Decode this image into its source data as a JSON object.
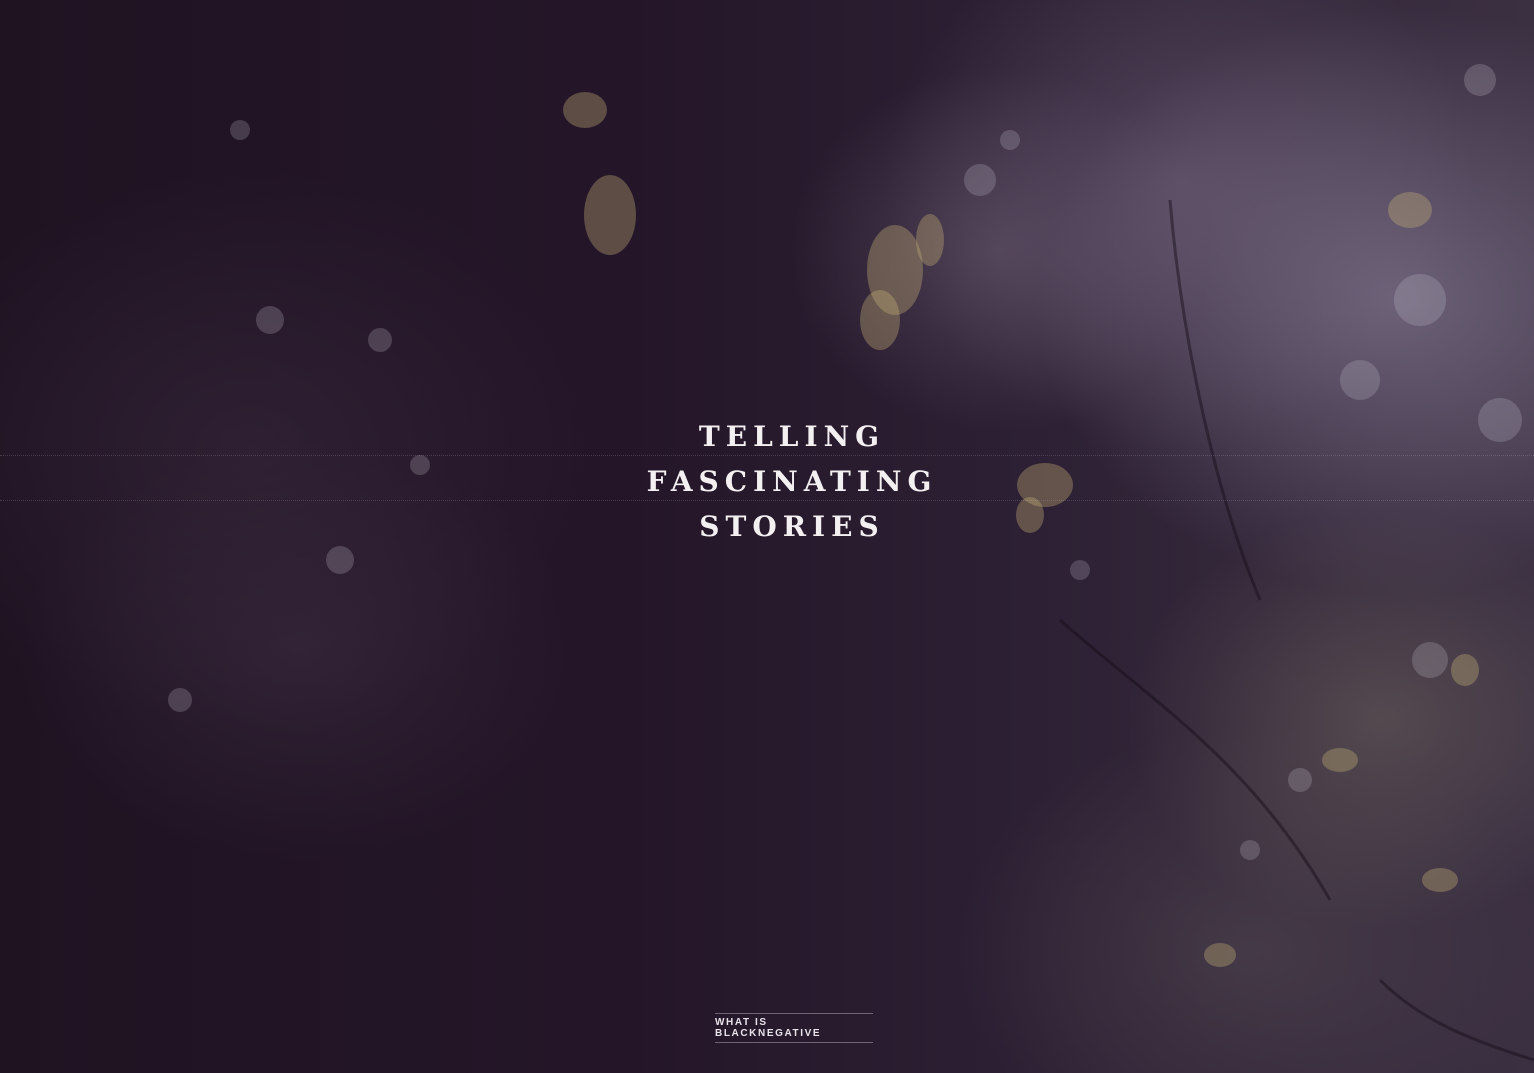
{
  "hero": {
    "headline_lines": [
      "TELLING",
      "FASCINATING",
      "STORIES"
    ]
  },
  "cta": {
    "label": "WHAT IS BLACKNEGATIVE"
  },
  "colors": {
    "background": "#1d1120",
    "text": "#f4f0f2"
  }
}
